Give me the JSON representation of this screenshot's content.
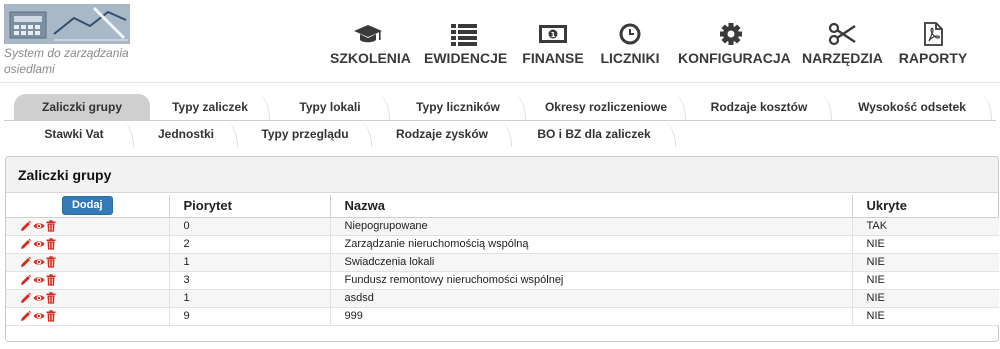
{
  "header": {
    "slogan": "System do zarządzania osiedlami",
    "nav": [
      {
        "label": "SZKOLENIA",
        "icon": "graduation-cap-icon"
      },
      {
        "label": "EWIDENCJE",
        "icon": "list-icon"
      },
      {
        "label": "FINANSE",
        "icon": "money-icon"
      },
      {
        "label": "LICZNIKI",
        "icon": "clock-icon"
      },
      {
        "label": "KONFIGURACJA",
        "icon": "gear-icon"
      },
      {
        "label": "NARZĘDZIA",
        "icon": "scissors-icon"
      },
      {
        "label": "RAPORTY",
        "icon": "pdf-file-icon"
      }
    ]
  },
  "tabs": {
    "row1": [
      "Zaliczki grupy",
      "Typy zaliczek",
      "Typy lokali",
      "Typy liczników",
      "Okresy rozliczeniowe",
      "Rodzaje kosztów",
      "Wysokość odsetek"
    ],
    "row2": [
      "Stawki Vat",
      "Jednostki",
      "Typy przeglądu",
      "Rodzaje zysków",
      "BO i BZ dla zaliczek"
    ],
    "active": "Zaliczki grupy"
  },
  "panel": {
    "title": "Zaliczki grupy",
    "add_label": "Dodaj",
    "columns": [
      "Piorytet",
      "Nazwa",
      "Ukryte"
    ],
    "rows": [
      {
        "priority": "0",
        "name": "Niepogrupowane",
        "hidden": "TAK"
      },
      {
        "priority": "2",
        "name": "Zarządzanie nieruchomością wspólną",
        "hidden": "NIE"
      },
      {
        "priority": "1",
        "name": "Swiadczenia lokali",
        "hidden": "NIE"
      },
      {
        "priority": "3",
        "name": "Fundusz remontowy nieruchomości wspólnej",
        "hidden": "NIE"
      },
      {
        "priority": "1",
        "name": "asdsd",
        "hidden": "NIE"
      },
      {
        "priority": "9",
        "name": "999",
        "hidden": "NIE"
      }
    ],
    "action_icons": [
      "edit-icon",
      "view-icon",
      "delete-icon"
    ],
    "action_color": "#d9291c"
  }
}
